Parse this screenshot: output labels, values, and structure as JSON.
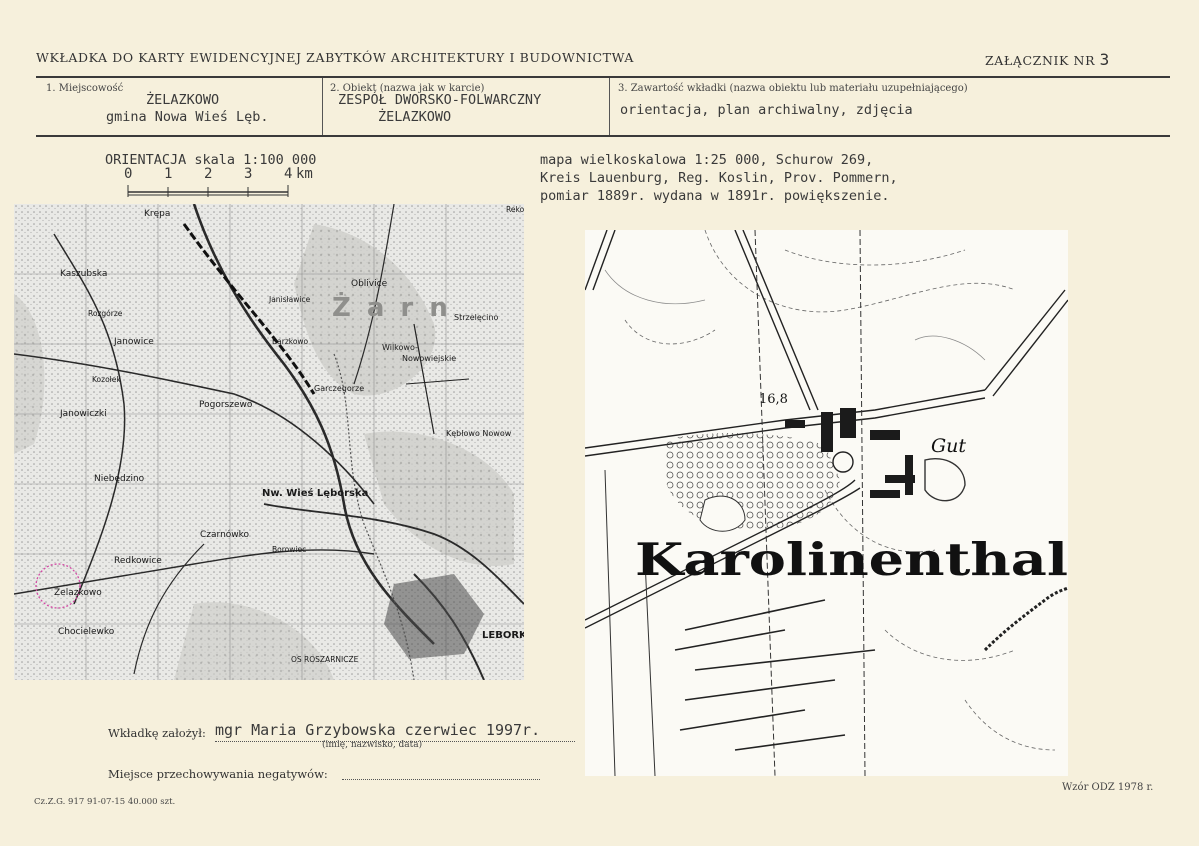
{
  "header": {
    "title": "WKŁADKA DO KARTY EWIDENCYJNEJ ZABYTKÓW ARCHITEKTURY I BUDOWNICTWA",
    "annex_label": "ZAŁĄCZNIK NR",
    "annex_number": "3"
  },
  "fields": {
    "locality": {
      "label": "1. Miejscowość",
      "line1": "ŻELAZKOWO",
      "line2": "gmina Nowa Wieś Lęb."
    },
    "object": {
      "label": "2. Obiekt (nazwa jak w karcie)",
      "line1": "ZESPÓŁ DWORSKO-FOLWARCZNY",
      "line2": "ŻELAZKOWO"
    },
    "contents": {
      "label": "3. Zawartość wkładki (nazwa obiektu lub materiału uzupełniającego)",
      "value": "orientacja, plan archiwalny, zdjęcia"
    }
  },
  "orientation": {
    "caption": "ORIENTACJA skala 1:100 000",
    "scale_ticks": [
      "0",
      "1",
      "2",
      "3",
      "4"
    ],
    "scale_unit": "km",
    "map_labels": {
      "krepa": "Krępa",
      "kaszubska": "Kaszubska",
      "oblivice": "Oblivice",
      "janislawice": "Janisławice",
      "rozgorze": "Rozgórze",
      "janowice": "Janowice",
      "barzkowo": "Barzkowo",
      "strzelecino": "Strzelęcino",
      "wilkowo": "Wilkowo-",
      "nowowiejskie": "Nowowiejskie",
      "kozolek": "Kozołek",
      "pogorszewo": "Pogorszewo",
      "garczegorze": "Garczegorze",
      "janowiczki": "Janowiczki",
      "keblowo": "Kębłowo Nowow",
      "niebedzino": "Niebędzino",
      "nw_wies": "Nw. Wieś Lęborska",
      "czarnowko": "Czarnówko",
      "borowiec": "Borowiec",
      "redkowice": "Redkowice",
      "zelazkowo": "Żelazkowo",
      "chocielewko": "Chocielewko",
      "lebork": "LEBORK",
      "roszarnicze": "OS ROSZARNICZE",
      "reko": "Reko",
      "zarn": "Żarn"
    }
  },
  "archive_map": {
    "caption_line1": "mapa wielkoskalowa 1:25 000, Schurow 269,",
    "caption_line2": "Kreis Lauenburg, Reg. Koslin, Prov. Pommern,",
    "caption_line3": "pomiar 1889r. wydana w 1891r. powiększenie.",
    "place_name": "Karolinenthal",
    "gut_label": "Gut",
    "elevation": "16,8"
  },
  "footer": {
    "author_label": "Wkładkę założył:",
    "author_value": "mgr Maria Grzybowska czerwiec 1997r.",
    "author_hint": "(imię, nazwisko, data)",
    "negatives_label": "Miejsce przechowywania negatywów:",
    "print_note": "Cz.Z.G. 917 91-07-15 40.000 szt.",
    "template_note": "Wzór ODZ 1978 r."
  }
}
